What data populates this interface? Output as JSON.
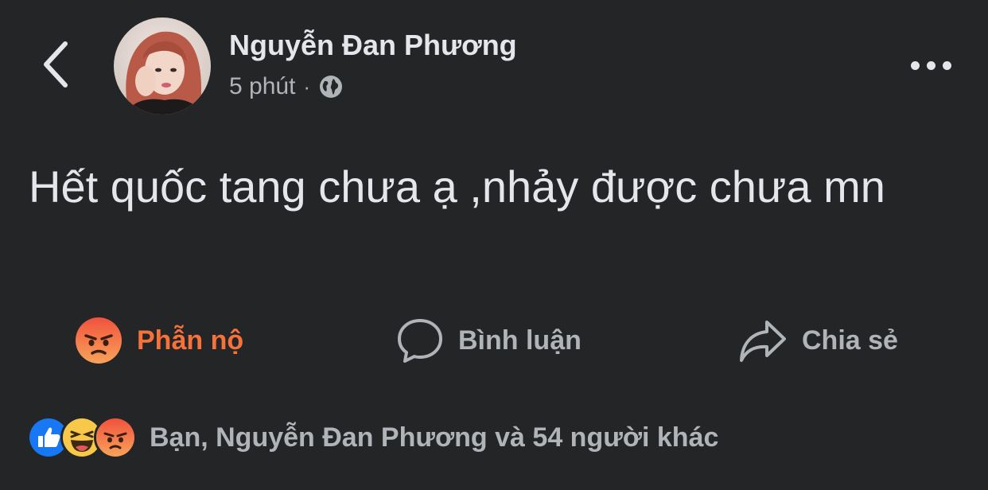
{
  "header": {
    "author_name": "Nguyễn Đan Phương",
    "timestamp": "5 phút",
    "separator": "·",
    "privacy_icon": "globe-icon",
    "back_icon": "chevron-left-icon",
    "more_icon": "more-horizontal-icon"
  },
  "post": {
    "text": "Hết quốc tang chưa ạ ,nhảy được chưa mn"
  },
  "actions": {
    "reaction_label": "Phẫn nộ",
    "reaction_icon": "angry-emoji-icon",
    "comment_label": "Bình luận",
    "comment_icon": "comment-bubble-icon",
    "share_label": "Chia sẻ",
    "share_icon": "share-arrow-icon"
  },
  "reactions_summary": {
    "icons": [
      "like-icon",
      "haha-icon",
      "angry-icon"
    ],
    "text": "Bạn, Nguyễn Đan Phương và 54 người khác"
  },
  "colors": {
    "background": "#242526",
    "primary_text": "#e4e6eb",
    "secondary_text": "#b0b3b8",
    "angry_accent": "#f7713b",
    "like_blue": "#1877f2"
  }
}
